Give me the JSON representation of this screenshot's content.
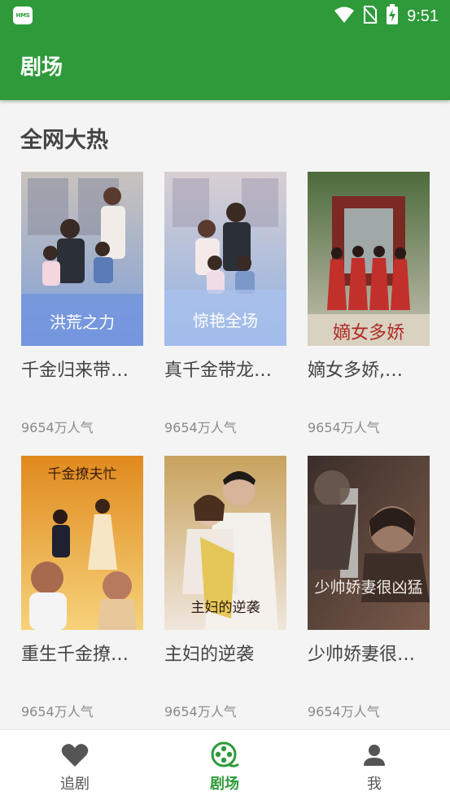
{
  "status_bar": {
    "badge": "HMS",
    "time": "9:51",
    "icons": [
      "wifi-icon",
      "no-sim-icon",
      "battery-charging-icon"
    ]
  },
  "app_bar": {
    "title": "剧场"
  },
  "section": {
    "title": "全网大热"
  },
  "dramas": [
    {
      "title": "千金归来带…",
      "popularity": "9654万人气",
      "poster_text": "洪荒之力",
      "poster_colors": [
        "#c9c3bd",
        "#7f9fd8"
      ]
    },
    {
      "title": "真千金带龙…",
      "popularity": "9654万人气",
      "poster_text": "惊艳全场",
      "poster_colors": [
        "#d8cfd2",
        "#8fb0e4"
      ]
    },
    {
      "title": "嫡女多娇,…",
      "popularity": "9654万人气",
      "poster_text": "嫡女多娇",
      "poster_colors": [
        "#5c7a4a",
        "#b83a3a"
      ]
    },
    {
      "title": "重生千金撩…",
      "popularity": "9654万人气",
      "poster_text": "千金撩夫忙",
      "poster_colors": [
        "#e59a2a",
        "#f2c97a"
      ]
    },
    {
      "title": "主妇的逆袭",
      "popularity": "9654万人气",
      "poster_text": "主妇的逆袭",
      "poster_colors": [
        "#c9a96b",
        "#f0e6d8"
      ]
    },
    {
      "title": "少帅娇妻很…",
      "popularity": "9654万人气",
      "poster_text": "少帅娇妻很凶猛",
      "poster_colors": [
        "#3a2e2a",
        "#8a6a5a"
      ]
    }
  ],
  "bottom_nav": [
    {
      "label": "追剧",
      "icon": "heart-icon",
      "active": false
    },
    {
      "label": "剧场",
      "icon": "film-reel-icon",
      "active": true
    },
    {
      "label": "我",
      "icon": "person-icon",
      "active": false
    }
  ],
  "colors": {
    "brand": "#2e9a3a",
    "text": "#444444",
    "muted": "#8a8a8a"
  }
}
